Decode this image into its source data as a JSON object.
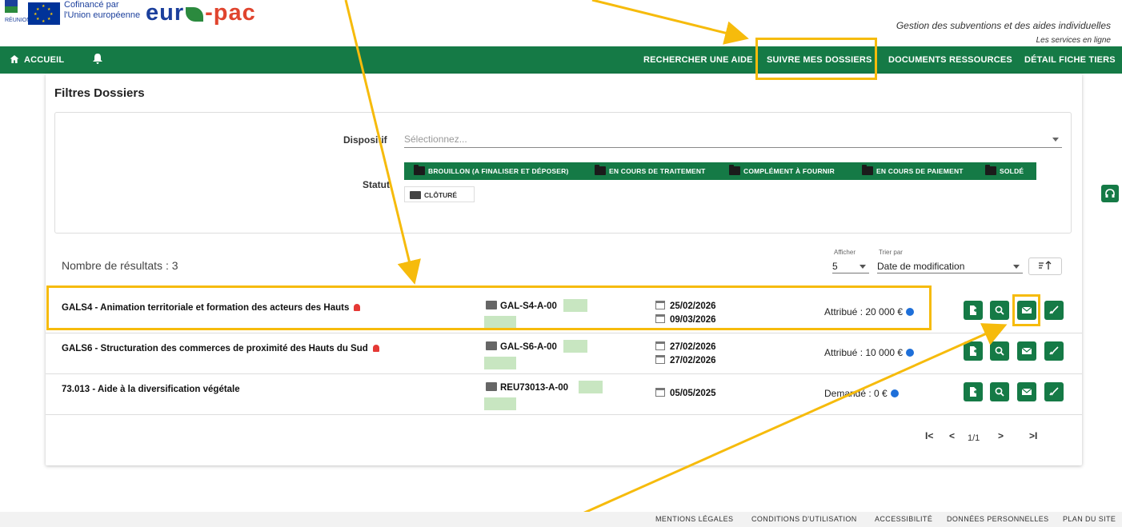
{
  "header": {
    "cofinancement_line1": "Cofinancé par",
    "cofinancement_line2": "l'Union européenne",
    "brand_left": "eur",
    "brand_right": "-pac",
    "region_label": "RÉUNION",
    "tagline": "Gestion des subventions et des aides individuelles",
    "subtagline": "Les services en ligne"
  },
  "nav": {
    "home": "ACCUEIL",
    "items": [
      {
        "label": "RECHERCHER UNE AIDE"
      },
      {
        "label": "SUIVRE MES DOSSIERS"
      },
      {
        "label": "DOCUMENTS RESSOURCES"
      },
      {
        "label": "DÉTAIL FICHE TIERS"
      }
    ]
  },
  "filters": {
    "title": "Filtres Dossiers",
    "dispositif_label": "Dispositif",
    "dispositif_placeholder": "Sélectionnez...",
    "statut_label": "Statut",
    "statuts_selected": [
      {
        "label": "BROUILLON (A FINALISER ET DÉPOSER)"
      },
      {
        "label": "EN COURS DE TRAITEMENT"
      },
      {
        "label": "COMPLÉMENT À FOURNIR"
      },
      {
        "label": "EN COURS DE PAIEMENT"
      },
      {
        "label": "SOLDÉ"
      }
    ],
    "statut_unselected": "CLÔTURÉ"
  },
  "results": {
    "count_label": "Nombre de résultats : 3",
    "afficher_label": "Afficher",
    "afficher_value": "5",
    "trier_label": "Trier par",
    "trier_value": "Date de modification",
    "sort_icon": "sort-order-icon"
  },
  "rows": [
    {
      "title": "GALS4 - Animation territoriale et formation des acteurs des Hauts",
      "ref": "GAL-S4-A-00",
      "date1": "25/02/2026",
      "date2": "09/03/2026",
      "montant": "Attribué : 20 000 €"
    },
    {
      "title": "GALS6 - Structuration des commerces de proximité des Hauts du Sud",
      "ref": "GAL-S6-A-00",
      "date1": "27/02/2026",
      "date2": "27/02/2026",
      "montant": "Attribué : 10 000 €"
    },
    {
      "title": "73.013 - Aide à la diversification végétale",
      "ref": "REU73013-A-00",
      "date1": "",
      "date2": "05/05/2025",
      "montant": "Demandé : 0 €"
    }
  ],
  "pager": {
    "first": "I<",
    "prev": "<",
    "info": "1/1",
    "next": ">",
    "last": ">I"
  },
  "footer": {
    "links": [
      "MENTIONS LÉGALES",
      "CONDITIONS D'UTILISATION",
      "ACCESSIBILITÉ",
      "DONNÉES PERSONNELLES",
      "PLAN DU SITE"
    ]
  },
  "colors": {
    "primary_green": "#157a46",
    "annotation_yellow": "#f6bb0c",
    "brand_blue": "#1b3f9c",
    "brand_red": "#e0442e"
  }
}
